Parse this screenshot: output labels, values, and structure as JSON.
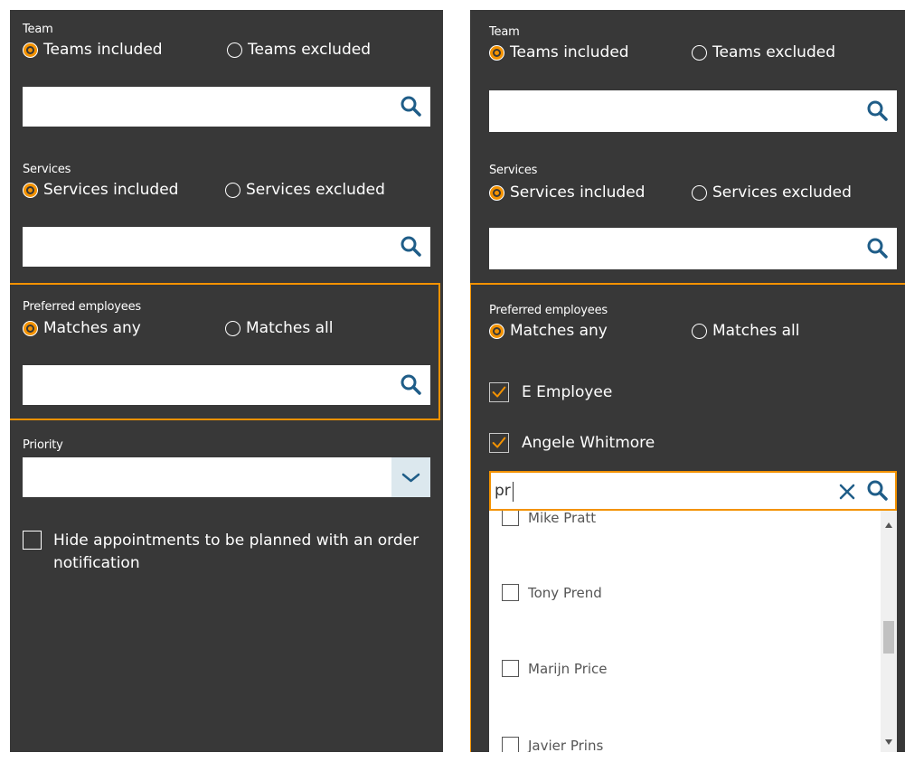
{
  "left": {
    "team": {
      "label": "Team",
      "option_included": "Teams included",
      "option_excluded": "Teams excluded"
    },
    "services": {
      "label": "Services",
      "option_included": "Services included",
      "option_excluded": "Services excluded"
    },
    "preferred": {
      "label": "Preferred employees",
      "option_any": "Matches any",
      "option_all": "Matches all"
    },
    "priority": {
      "label": "Priority"
    },
    "hide_appointments": {
      "label_line1": "Hide appointments to be planned with an order",
      "label_line2": "notification"
    }
  },
  "right": {
    "team": {
      "label": "Team",
      "option_included": "Teams included",
      "option_excluded": "Teams excluded"
    },
    "services": {
      "label": "Services",
      "option_included": "Services included",
      "option_excluded": "Services excluded"
    },
    "preferred": {
      "label": "Preferred employees",
      "option_any": "Matches any",
      "option_all": "Matches all",
      "selected": [
        "E Employee",
        "Angele Whitmore"
      ],
      "search_value": "pr",
      "results": [
        "Mike Pratt",
        "Tony Prend",
        "Marijn Price",
        "Javier Prins"
      ]
    }
  },
  "colors": {
    "panel_bg": "#383838",
    "accent": "#f39200",
    "icon_blue": "#1f5d88"
  }
}
